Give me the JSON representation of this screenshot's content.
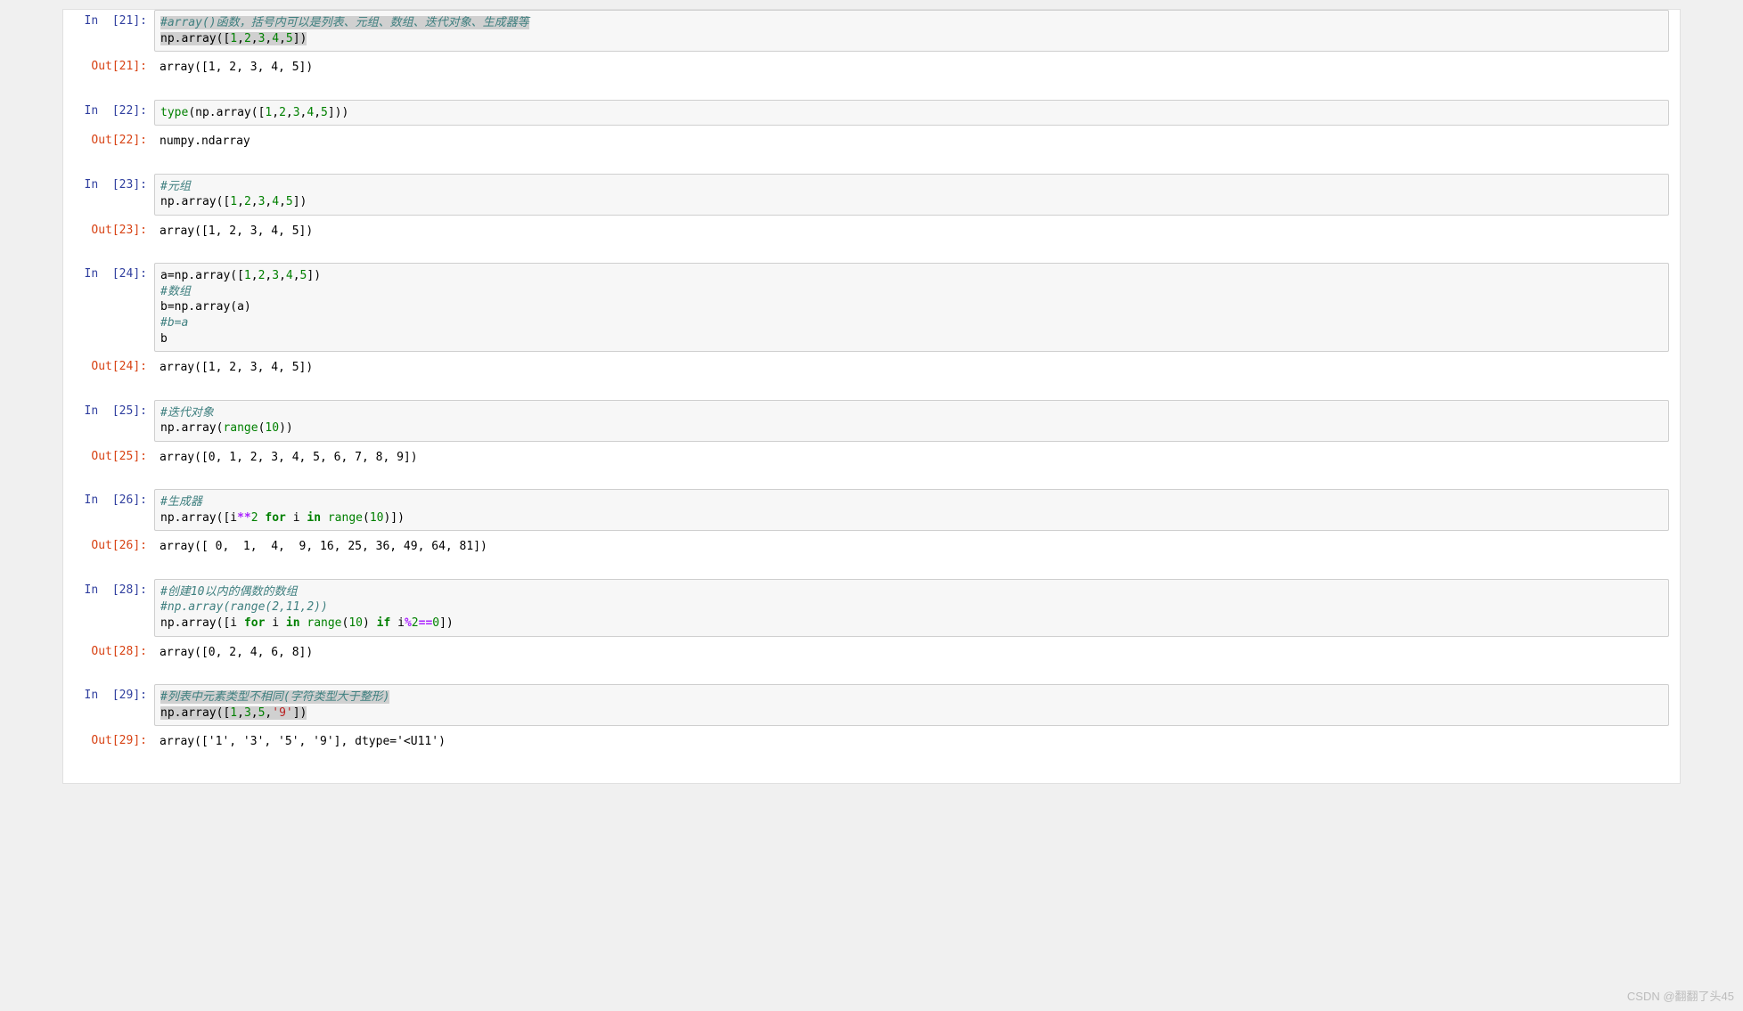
{
  "watermark": "CSDN @翻翻了头45",
  "cells": [
    {
      "in_n": 21,
      "code_tokens": [
        {
          "t": "#array()函数，括号内可以是列表、元组、数组、迭代对象、生成器等",
          "cls": "c-comment",
          "hl": true
        },
        {
          "t": "\n"
        },
        {
          "t": "np.array([",
          "hl": true
        },
        {
          "t": "1",
          "cls": "c-number",
          "hl": true
        },
        {
          "t": ",",
          "hl": true
        },
        {
          "t": "2",
          "cls": "c-number",
          "hl": true
        },
        {
          "t": ",",
          "hl": true
        },
        {
          "t": "3",
          "cls": "c-number",
          "hl": true
        },
        {
          "t": ",",
          "hl": true
        },
        {
          "t": "4",
          "cls": "c-number",
          "hl": true
        },
        {
          "t": ",",
          "hl": true
        },
        {
          "t": "5",
          "cls": "c-number",
          "hl": true
        },
        {
          "t": "])",
          "hl": true
        }
      ],
      "out": "array([1, 2, 3, 4, 5])"
    },
    {
      "in_n": 22,
      "code_tokens": [
        {
          "t": "type",
          "cls": "c-builtin"
        },
        {
          "t": "(np.array(["
        },
        {
          "t": "1",
          "cls": "c-number"
        },
        {
          "t": ","
        },
        {
          "t": "2",
          "cls": "c-number"
        },
        {
          "t": ","
        },
        {
          "t": "3",
          "cls": "c-number"
        },
        {
          "t": ","
        },
        {
          "t": "4",
          "cls": "c-number"
        },
        {
          "t": ","
        },
        {
          "t": "5",
          "cls": "c-number"
        },
        {
          "t": "]))"
        }
      ],
      "out": "numpy.ndarray"
    },
    {
      "in_n": 23,
      "code_tokens": [
        {
          "t": "#元组",
          "cls": "c-comment"
        },
        {
          "t": "\n"
        },
        {
          "t": "np.array(["
        },
        {
          "t": "1",
          "cls": "c-number"
        },
        {
          "t": ","
        },
        {
          "t": "2",
          "cls": "c-number"
        },
        {
          "t": ","
        },
        {
          "t": "3",
          "cls": "c-number"
        },
        {
          "t": ","
        },
        {
          "t": "4",
          "cls": "c-number"
        },
        {
          "t": ","
        },
        {
          "t": "5",
          "cls": "c-number"
        },
        {
          "t": "])"
        }
      ],
      "out": "array([1, 2, 3, 4, 5])"
    },
    {
      "in_n": 24,
      "code_tokens": [
        {
          "t": "a=np.array(["
        },
        {
          "t": "1",
          "cls": "c-number"
        },
        {
          "t": ","
        },
        {
          "t": "2",
          "cls": "c-number"
        },
        {
          "t": ","
        },
        {
          "t": "3",
          "cls": "c-number"
        },
        {
          "t": ","
        },
        {
          "t": "4",
          "cls": "c-number"
        },
        {
          "t": ","
        },
        {
          "t": "5",
          "cls": "c-number"
        },
        {
          "t": "])"
        },
        {
          "t": "\n"
        },
        {
          "t": "#数组",
          "cls": "c-comment"
        },
        {
          "t": "\n"
        },
        {
          "t": "b=np.array(a)"
        },
        {
          "t": "\n"
        },
        {
          "t": "#b=a",
          "cls": "c-comment"
        },
        {
          "t": "\n"
        },
        {
          "t": "b"
        }
      ],
      "out": "array([1, 2, 3, 4, 5])"
    },
    {
      "in_n": 25,
      "code_tokens": [
        {
          "t": "#迭代对象",
          "cls": "c-comment"
        },
        {
          "t": "\n"
        },
        {
          "t": "np.array("
        },
        {
          "t": "range",
          "cls": "c-builtin"
        },
        {
          "t": "("
        },
        {
          "t": "10",
          "cls": "c-number"
        },
        {
          "t": "))"
        }
      ],
      "out": "array([0, 1, 2, 3, 4, 5, 6, 7, 8, 9])"
    },
    {
      "in_n": 26,
      "code_tokens": [
        {
          "t": "#生成器",
          "cls": "c-comment"
        },
        {
          "t": "\n"
        },
        {
          "t": "np.array([i"
        },
        {
          "t": "**",
          "cls": "c-operator"
        },
        {
          "t": "2",
          "cls": "c-number"
        },
        {
          "t": " "
        },
        {
          "t": "for",
          "cls": "c-keyword"
        },
        {
          "t": " i "
        },
        {
          "t": "in",
          "cls": "c-keyword"
        },
        {
          "t": " "
        },
        {
          "t": "range",
          "cls": "c-builtin"
        },
        {
          "t": "("
        },
        {
          "t": "10",
          "cls": "c-number"
        },
        {
          "t": ")])"
        }
      ],
      "out": "array([ 0,  1,  4,  9, 16, 25, 36, 49, 64, 81])"
    },
    {
      "in_n": 28,
      "code_tokens": [
        {
          "t": "#创建10以内的偶数的数组",
          "cls": "c-comment"
        },
        {
          "t": "\n"
        },
        {
          "t": "#np.array(range(2,11,2))",
          "cls": "c-comment"
        },
        {
          "t": "\n"
        },
        {
          "t": "np.array([i "
        },
        {
          "t": "for",
          "cls": "c-keyword"
        },
        {
          "t": " i "
        },
        {
          "t": "in",
          "cls": "c-keyword"
        },
        {
          "t": " "
        },
        {
          "t": "range",
          "cls": "c-builtin"
        },
        {
          "t": "("
        },
        {
          "t": "10",
          "cls": "c-number"
        },
        {
          "t": ") "
        },
        {
          "t": "if",
          "cls": "c-keyword"
        },
        {
          "t": " i"
        },
        {
          "t": "%",
          "cls": "c-operator"
        },
        {
          "t": "2",
          "cls": "c-number"
        },
        {
          "t": "==",
          "cls": "c-operator"
        },
        {
          "t": "0",
          "cls": "c-number"
        },
        {
          "t": "])"
        }
      ],
      "out": "array([0, 2, 4, 6, 8])"
    },
    {
      "in_n": 29,
      "code_tokens": [
        {
          "t": "#列表中元素类型不相同(字符类型大于整形)",
          "cls": "c-comment",
          "hl": true
        },
        {
          "t": "\n"
        },
        {
          "t": "np.array([",
          "hl": true
        },
        {
          "t": "1",
          "cls": "c-number",
          "hl": true
        },
        {
          "t": ",",
          "hl": true
        },
        {
          "t": "3",
          "cls": "c-number",
          "hl": true
        },
        {
          "t": ",",
          "hl": true
        },
        {
          "t": "5",
          "cls": "c-number",
          "hl": true
        },
        {
          "t": ",",
          "hl": true
        },
        {
          "t": "'9'",
          "cls": "c-string",
          "hl": true
        },
        {
          "t": "])",
          "hl": true
        }
      ],
      "out": "array(['1', '3', '5', '9'], dtype='<U11')"
    }
  ]
}
